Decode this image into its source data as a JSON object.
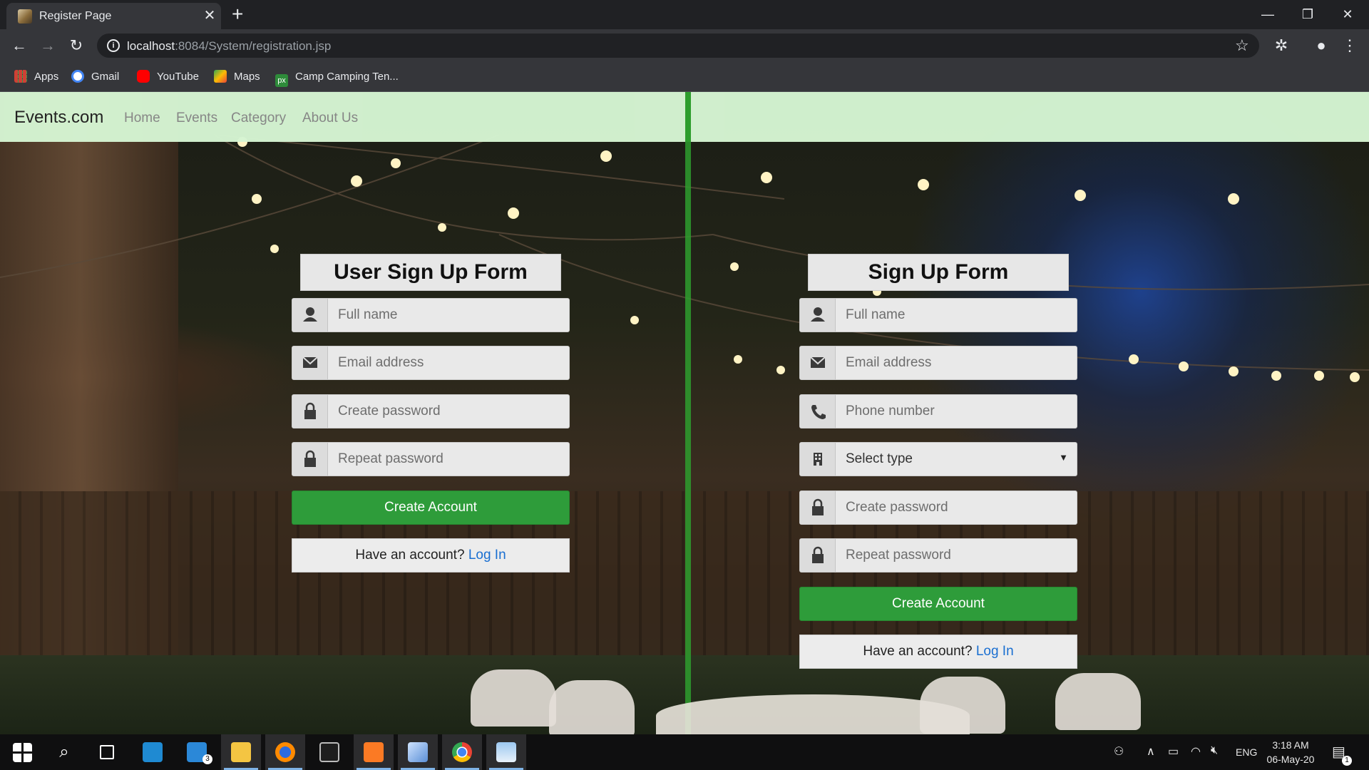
{
  "browser": {
    "tab_title": "Register Page",
    "url_host": "localhost",
    "url_rest": ":8084/System/registration.jsp",
    "bookmarks": [
      "Apps",
      "Gmail",
      "YouTube",
      "Maps",
      "Camp Camping Ten..."
    ]
  },
  "site": {
    "brand": "Events.com",
    "nav": [
      "Home",
      "Events",
      "Category",
      "About Us"
    ]
  },
  "user_form": {
    "title": "User Sign Up Form",
    "full_name_placeholder": "Full name",
    "email_placeholder": "Email address",
    "password_placeholder": "Create password",
    "repeat_placeholder": "Repeat password",
    "create_label": "Create Account",
    "have_account": "Have an account?",
    "login_link": "Log In"
  },
  "org_form": {
    "title": "Sign Up Form",
    "full_name_placeholder": "Full name",
    "email_placeholder": "Email address",
    "phone_placeholder": "Phone number",
    "type_selected": "Select type",
    "password_placeholder": "Create password",
    "repeat_placeholder": "Repeat password",
    "create_label": "Create Account",
    "have_account": "Have an account?",
    "login_link": "Log In"
  },
  "taskbar": {
    "mail_badge": "3",
    "language": "ENG",
    "time": "3:18 AM",
    "date": "06-May-20",
    "notifications": "1"
  },
  "colors": {
    "accent_green": "#2e9c3a",
    "nav_bg": "#d6f5d3",
    "link_blue": "#1a6fd1"
  }
}
